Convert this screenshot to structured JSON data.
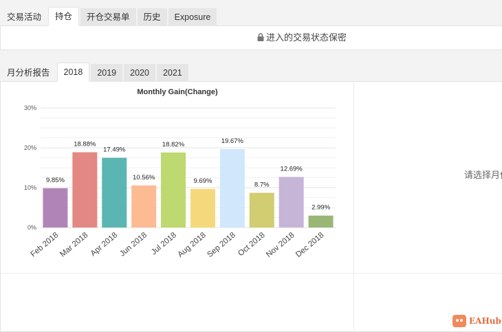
{
  "top_tabs": {
    "activity": "交易活动",
    "positions": "持仓",
    "open_orders": "开仓交易单",
    "history": "历史",
    "exposure": "Exposure"
  },
  "lock_message": "进入的交易状态保密",
  "report": {
    "label": "月分析报告",
    "years": [
      "2018",
      "2019",
      "2020",
      "2021"
    ],
    "active_year": "2018"
  },
  "select_hint": "请选择月份",
  "logo_text": "EAHub",
  "chart_data": {
    "type": "bar",
    "title": "Monthly Gain(Change)",
    "categories": [
      "Feb 2018",
      "Mar 2018",
      "Apr 2018",
      "Jun 2018",
      "Jul 2018",
      "Aug 2018",
      "Sep 2018",
      "Oct 2018",
      "Nov 2018",
      "Dec 2018"
    ],
    "values": [
      9.85,
      18.88,
      17.49,
      10.56,
      18.82,
      9.69,
      19.67,
      8.7,
      12.69,
      2.99
    ],
    "data_labels": [
      "9.85%",
      "18.88%",
      "17.49%",
      "10.56%",
      "18.82%",
      "9.69%",
      "19.67%",
      "8.7%",
      "12.69%",
      "2.99%"
    ],
    "colors": [
      "#b184b8",
      "#e48883",
      "#5ab5b3",
      "#fdbb94",
      "#bdd96f",
      "#f6d87c",
      "#d1e7fb",
      "#d1cd70",
      "#c7b5d8",
      "#99b676"
    ],
    "y_ticks": [
      "0%",
      "10%",
      "20%",
      "30%"
    ],
    "ylim": [
      0,
      30
    ],
    "grid": true
  }
}
